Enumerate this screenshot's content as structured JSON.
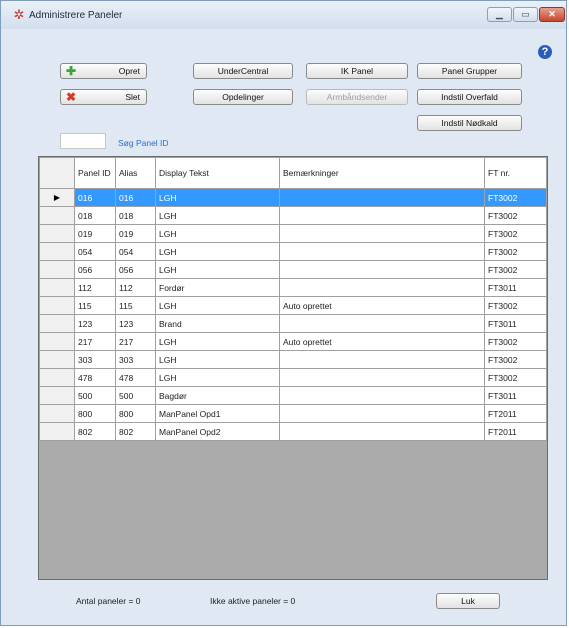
{
  "window": {
    "title": "Administrere Paneler"
  },
  "buttons": {
    "opret": "Opret",
    "slet": "Slet",
    "undercentral": "UnderCentral",
    "opdelinger": "Opdelinger",
    "ik_panel": "IK Panel",
    "armbaandsender": "Armbåndsender",
    "panel_grupper": "Panel Grupper",
    "indstil_overfald": "Indstil Overfald",
    "indstil_noedkald": "Indstil Nødkald",
    "luk": "Luk"
  },
  "search": {
    "value": "",
    "label": "Søg Panel ID"
  },
  "grid": {
    "columns": [
      "Panel ID",
      "Alias",
      "Display Tekst",
      "Bemærkninger",
      "FT nr."
    ],
    "rows": [
      [
        "016",
        "016",
        "LGH",
        "",
        "FT3002"
      ],
      [
        "018",
        "018",
        "LGH",
        "",
        "FT3002"
      ],
      [
        "019",
        "019",
        "LGH",
        "",
        "FT3002"
      ],
      [
        "054",
        "054",
        "LGH",
        "",
        "FT3002"
      ],
      [
        "056",
        "056",
        "LGH",
        "",
        "FT3002"
      ],
      [
        "112",
        "112",
        "Fordør",
        "",
        "FT3011"
      ],
      [
        "115",
        "115",
        "LGH",
        "Auto oprettet",
        "FT3002"
      ],
      [
        "123",
        "123",
        "Brand",
        "",
        "FT3011"
      ],
      [
        "217",
        "217",
        "LGH",
        "Auto oprettet",
        "FT3002"
      ],
      [
        "303",
        "303",
        "LGH",
        "",
        "FT3002"
      ],
      [
        "478",
        "478",
        "LGH",
        "",
        "FT3002"
      ],
      [
        "500",
        "500",
        "Bagdør",
        "",
        "FT3011"
      ],
      [
        "800",
        "800",
        "ManPanel Opd1",
        "",
        "FT2011"
      ],
      [
        "802",
        "802",
        "ManPanel Opd2",
        "",
        "FT2011"
      ]
    ],
    "selected_row": 0
  },
  "status": {
    "antal": "Antal paneler = 0",
    "ikke_aktive": "Ikke aktive paneler = 0"
  },
  "colors": {
    "selection": "#3399ff",
    "link": "#2c6fd1"
  },
  "icons": {
    "add": "plus-icon",
    "delete": "x-icon",
    "help": "question-icon",
    "app": "star-icon"
  }
}
